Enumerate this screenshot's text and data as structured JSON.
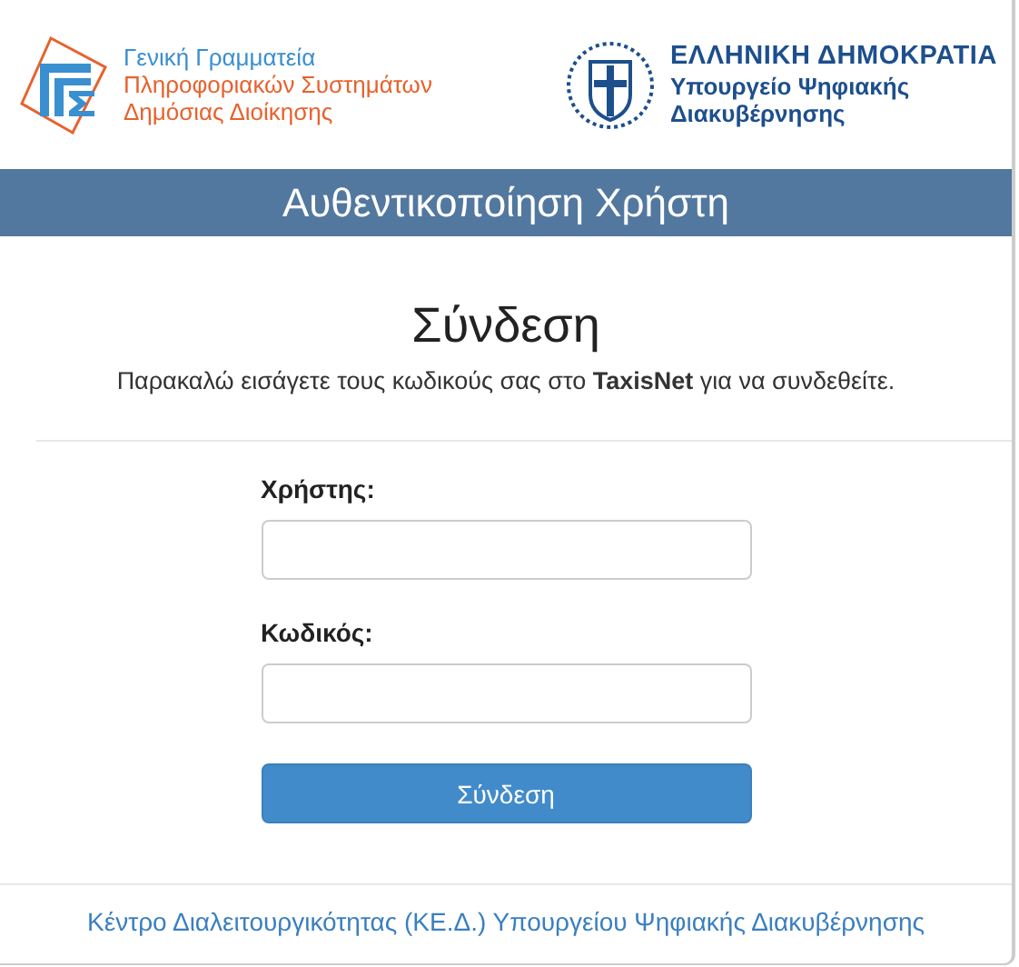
{
  "header": {
    "left_logo": {
      "lines": [
        {
          "text": "Γενική Γραμματεία",
          "kind": "accent"
        },
        {
          "text": "Πληροφοριακών Συστημάτων",
          "kind": "main"
        },
        {
          "text": "Δημόσιας Διοίκησης",
          "kind": "main"
        }
      ]
    },
    "right_logo": {
      "title": "ΕΛΛΗΝΙΚΗ ΔΗΜΟΚΡΑΤΙΑ",
      "lines": [
        "Υπουργείο Ψηφιακής",
        "Διακυβέρνησης"
      ]
    }
  },
  "banner": {
    "title": "Αυθεντικοποίηση Χρήστη"
  },
  "login": {
    "heading": "Σύνδεση",
    "instructions": "Παρακαλώ εισάγετε τους κωδικούς σας στο **TaxisNet** για να συνδεθείτε.",
    "fields": [
      {
        "label": "Χρήστης:"
      },
      {
        "label": "Κωδικός:"
      }
    ],
    "submit": "Σύνδεση"
  },
  "footer": {
    "link": "Κέντρο Διαλειτουργικότητας (ΚΕ.Δ.) Υπουργείου Ψηφιακής Διακυβέρνησης"
  }
}
